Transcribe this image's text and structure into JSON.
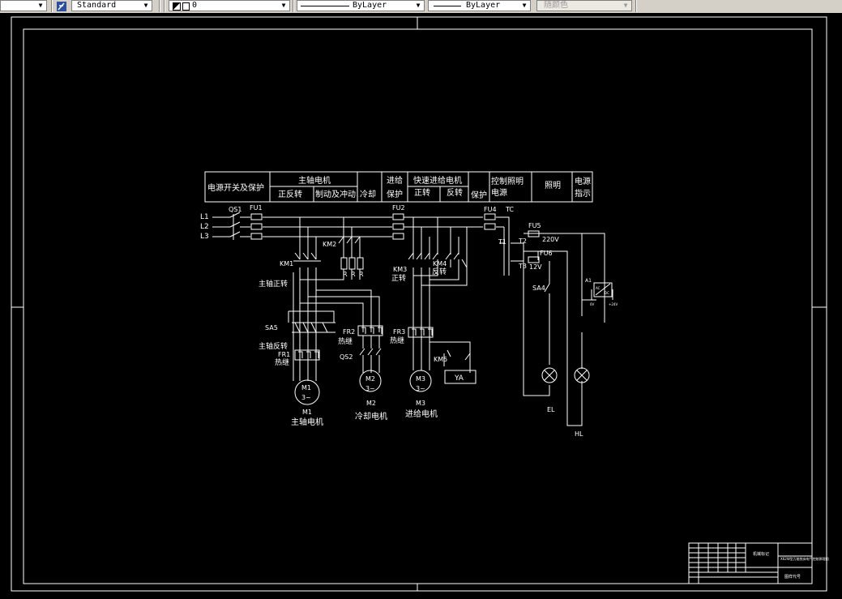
{
  "toolbar": {
    "text_style": "Standard",
    "layer": "0",
    "linetype": "ByLayer",
    "lineweight": "ByLayer",
    "plot_style": "随颜色",
    "colors": {
      "bg": "#d4d0c8",
      "field_bg": "#ffffff",
      "disabled_bg": "#ece9e3"
    }
  },
  "drawing": {
    "background": "#000000",
    "line_color": "#ffffff",
    "header_cells": {
      "power_switch": "电源开关及保护",
      "spindle_motor": "主轴电机",
      "forward_reverse": "正反转",
      "brake": "制动及冲动",
      "cooling": "冷却",
      "feed": "进给",
      "feed_protect": "保护",
      "fast_feed_motor": "快速进给电机",
      "forward": "正转",
      "reverse": "反转",
      "protect": "保护",
      "control_light": "控制照明",
      "power_source": "电源",
      "lighting": "照明",
      "power_ind_1": "电源",
      "power_ind_2": "指示"
    },
    "labels": {
      "L1": "L1",
      "L2": "L2",
      "L3": "L3",
      "QS1": "QS1",
      "FU1": "FU1",
      "FU2": "FU2",
      "FU4": "FU4",
      "TC": "TC",
      "FU5": "FU5",
      "v220": "220V",
      "FU6": "FU6",
      "v12": "12V",
      "T1": "T1",
      "T2": "T2",
      "T3": "T3",
      "KM1": "KM1",
      "KM2": "KM2",
      "KM3": "KM3",
      "KM4": "KM4",
      "KM5": "KM5",
      "R1": "R",
      "R2": "R",
      "R3": "R",
      "spindle_fwd": "主轴正转",
      "spindle_rev": "主轴反转",
      "reverse": "反转",
      "forward": "正转",
      "SA5": "SA5",
      "SA4": "SA4",
      "FR1": "FR1",
      "FR2": "FR2",
      "FR3": "FR3",
      "thermal1": "热继",
      "thermal2": "热继",
      "thermal3": "热继",
      "QS2": "QS2",
      "YA": "YA",
      "A1": "A1",
      "M1": "M1",
      "M2": "M2",
      "M3": "M3",
      "phase": "3~",
      "M1_name": "M1",
      "M2_name": "M2",
      "M3_name": "M3",
      "M1_desc": "主轴电机",
      "M2_desc": "冷却电机",
      "M3_desc": "进给电机",
      "EL": "EL",
      "HL": "HL",
      "out0v": "0V",
      "out24v": "+24V",
      "ac": "AC",
      "dc": "DC"
    },
    "title_block": {
      "caption": "机械标记",
      "drawing_name": "X62W型万能铣床电气控制原理图",
      "drawing_no": "图样代号"
    }
  }
}
